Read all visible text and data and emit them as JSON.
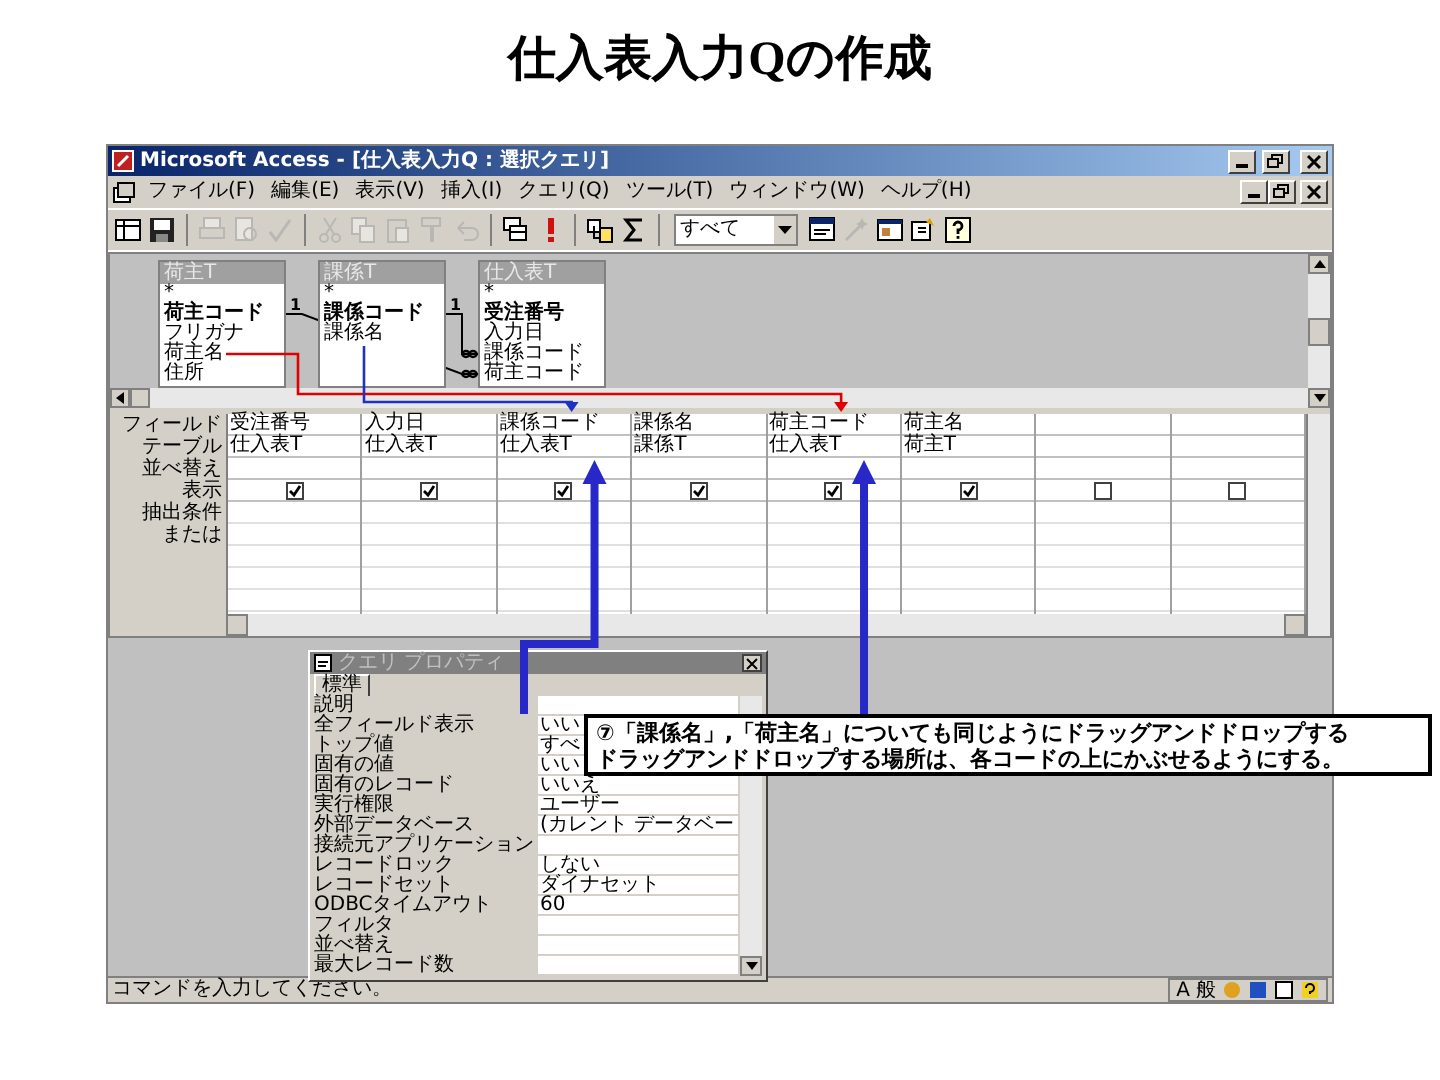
{
  "slide_title": "仕入表入力Qの作成",
  "window": {
    "title": "Microsoft Access - [仕入表入力Q : 選択クエリ]",
    "menu": [
      "ファイル(F)",
      "編集(E)",
      "表示(V)",
      "挿入(I)",
      "クエリ(Q)",
      "ツール(T)",
      "ウィンドウ(W)",
      "ヘルプ(H)"
    ],
    "toolbar": [
      {
        "kind": "view",
        "disabled": false
      },
      {
        "kind": "save",
        "disabled": false
      },
      {
        "kind": "print",
        "disabled": true
      },
      {
        "kind": "preview",
        "disabled": true
      },
      {
        "kind": "spell",
        "disabled": true
      },
      {
        "kind": "cut",
        "disabled": true
      },
      {
        "kind": "copy",
        "disabled": true
      },
      {
        "kind": "paste",
        "disabled": true
      },
      {
        "kind": "painter",
        "disabled": true
      },
      {
        "kind": "undo",
        "disabled": true
      },
      {
        "kind": "querytype",
        "disabled": false
      },
      {
        "kind": "run",
        "disabled": false
      },
      {
        "kind": "showtable",
        "disabled": false
      },
      {
        "kind": "totals",
        "disabled": false
      },
      {
        "kind": "combo",
        "value": "すべて"
      },
      {
        "kind": "properties",
        "disabled": false
      },
      {
        "kind": "build",
        "disabled": true
      },
      {
        "kind": "dbwindow",
        "disabled": false
      },
      {
        "kind": "newobject",
        "disabled": false
      },
      {
        "kind": "help",
        "disabled": false
      }
    ],
    "field_lists": [
      {
        "title": "荷主T",
        "fields": [
          {
            "name": "*",
            "key": false
          },
          {
            "name": "荷主コード",
            "key": true
          },
          {
            "name": "フリガナ",
            "key": false
          },
          {
            "name": "荷主名",
            "key": false
          },
          {
            "name": "住所",
            "key": false
          }
        ]
      },
      {
        "title": "課係T",
        "fields": [
          {
            "name": "*",
            "key": false
          },
          {
            "name": "課係コード",
            "key": true
          },
          {
            "name": "課係名",
            "key": false
          }
        ]
      },
      {
        "title": "仕入表T",
        "fields": [
          {
            "name": "*",
            "key": false
          },
          {
            "name": "受注番号",
            "key": true
          },
          {
            "name": "入力日",
            "key": false
          },
          {
            "name": "課係コード",
            "key": false
          },
          {
            "name": "荷主コード",
            "key": false
          }
        ]
      }
    ],
    "relationships": [
      {
        "one": "1"
      },
      {
        "one": "1"
      }
    ],
    "grid": {
      "row_labels": [
        "フィールド",
        "テーブル",
        "並べ替え",
        "表示",
        "抽出条件",
        "または"
      ],
      "columns": [
        {
          "field": "受注番号",
          "table": "仕入表T",
          "show": true
        },
        {
          "field": "入力日",
          "table": "仕入表T",
          "show": true
        },
        {
          "field": "課係コード",
          "table": "仕入表T",
          "show": true
        },
        {
          "field": "課係名",
          "table": "課係T",
          "show": true
        },
        {
          "field": "荷主コード",
          "table": "仕入表T",
          "show": true
        },
        {
          "field": "荷主名",
          "table": "荷主T",
          "show": true
        },
        {
          "show": false
        },
        {
          "show": false
        }
      ]
    },
    "properties": {
      "title": "クエリ プロパティ",
      "tab": "標準",
      "rows": [
        {
          "label": "説明"
        },
        {
          "label": "全フィールド表示",
          "value": "いい"
        },
        {
          "label": "トップ値",
          "value": "すべ"
        },
        {
          "label": "固有の値",
          "value": "いい"
        },
        {
          "label": "固有のレコード",
          "value": "いいえ"
        },
        {
          "label": "実行権限",
          "value": "ユーザー"
        },
        {
          "label": "外部データベース",
          "value": "(カレント データベー"
        },
        {
          "label": "接続元アプリケーション"
        },
        {
          "label": "レコードロック",
          "value": "しない"
        },
        {
          "label": "レコードセット",
          "value": "ダイナセット"
        },
        {
          "label": "ODBCタイムアウト",
          "value": "60"
        },
        {
          "label": "フィルタ"
        },
        {
          "label": "並べ替え"
        },
        {
          "label": "最大レコード数"
        }
      ]
    },
    "status_bar": {
      "text": "コマンドを入力してください。",
      "ime": [
        "A",
        "般"
      ]
    }
  },
  "callout": {
    "lines": [
      "⑦「課係名」,「荷主名」についても同じようにドラッグアンドドロップする",
      "ドラッグアンドドロップする場所は、各コードの上にかぶせるようにする。"
    ]
  }
}
